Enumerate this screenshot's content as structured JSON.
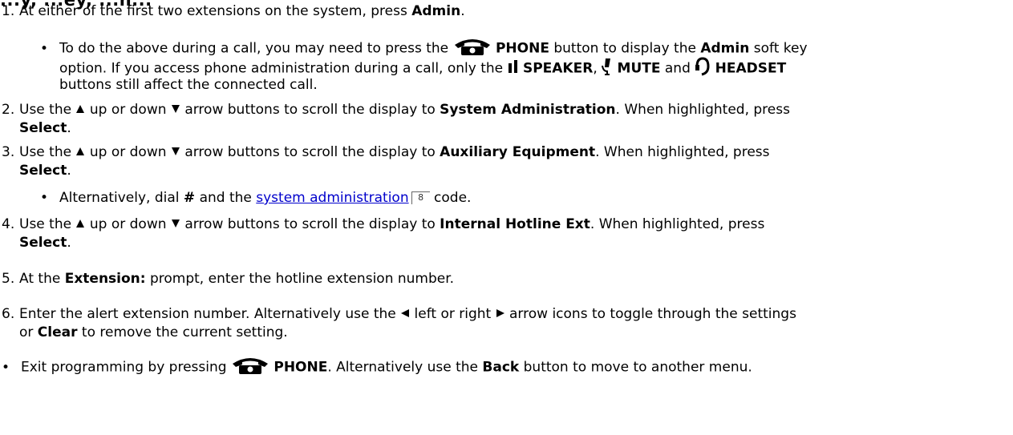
{
  "heading_fragment": "...y, ...ey, ...n...",
  "steps": {
    "s1": {
      "num": "1.",
      "a": "At either of the first two extensions on the system, press ",
      "b": "Admin",
      "c": "."
    },
    "s1b": {
      "l1a": "To do the above during a call, you may need to press the ",
      "l1b": "PHONE",
      "l1c": " button to display the ",
      "l1d": "Admin",
      "l1e": " soft key",
      "l2a": "option. If you access phone administration during a call, only the ",
      "l2b": "SPEAKER",
      "l2c": ", ",
      "l2d": "MUTE",
      "l2e": " and ",
      "l2f": "HEADSET",
      "l3": "buttons still affect the connected call."
    },
    "s2": {
      "num": "2.",
      "a": "Use the ",
      "b": " up or down ",
      "c": " arrow buttons to scroll the display to ",
      "d": "System Administration",
      "e": ". When highlighted, press",
      "f": "Select",
      "g": "."
    },
    "s3": {
      "num": "3.",
      "a": "Use the ",
      "b": " up or down ",
      "c": " arrow buttons to scroll the display to ",
      "d": "Auxiliary Equipment",
      "e": ". When highlighted, press",
      "f": "Select",
      "g": "."
    },
    "s3b": {
      "a": "Alternatively, dial ",
      "b": "#",
      "c": " and the ",
      "link": "system administration",
      "xref": "8",
      "d": " code."
    },
    "s4": {
      "num": "4.",
      "a": "Use the ",
      "b": " up or down ",
      "c": " arrow buttons to scroll the display to ",
      "d": "Internal Hotline Ext",
      "e": ". When highlighted, press",
      "f": "Select",
      "g": "."
    },
    "s5": {
      "num": "5.",
      "a": "At the ",
      "b": "Extension:",
      "c": " prompt, enter the hotline extension number."
    },
    "s6": {
      "num": "6.",
      "a": "Enter the alert extension number. Alternatively use the ",
      "b": " left or right ",
      "c": " arrow icons to toggle through the settings",
      "d": "or ",
      "e": "Clear",
      "f": " to remove the current setting."
    },
    "s7": {
      "a": "Exit programming by pressing ",
      "b": "PHONE",
      "c": ". Alternatively use the ",
      "d": "Back",
      "e": " button to move to another menu."
    }
  },
  "icons": [
    "phone-icon",
    "speaker-icon",
    "mute-icon",
    "headset-icon",
    "up-arrow-icon",
    "down-arrow-icon",
    "left-arrow-icon",
    "right-arrow-icon"
  ]
}
